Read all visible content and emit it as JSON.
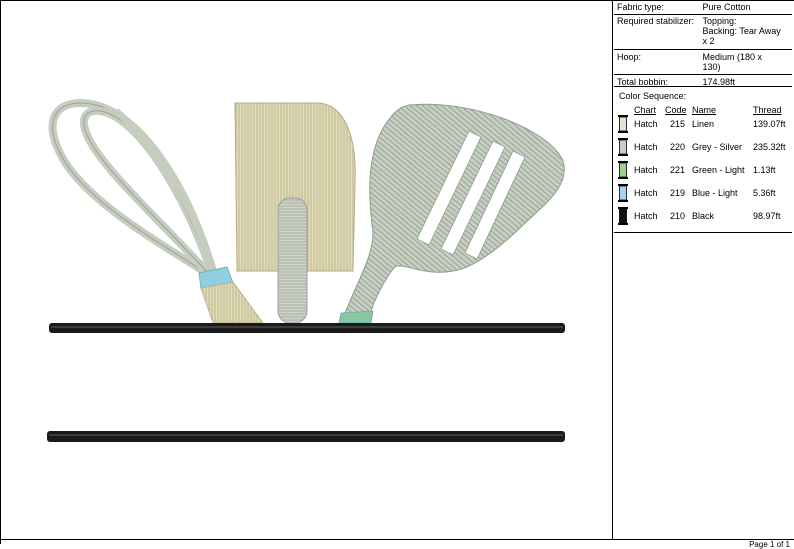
{
  "info": {
    "fabric_label": "Fabric type:",
    "fabric_value": "Pure Cotton",
    "stabilizer_label": "Required stabilizer:",
    "stabilizer_value_1": "Topping:",
    "stabilizer_value_2": "Backing: Tear Away",
    "stabilizer_value_3": "x 2",
    "hoop_label": "Hoop:",
    "hoop_value_1": "Medium (180 x",
    "hoop_value_2": "130)",
    "bobbin_label": "Total bobbin:",
    "bobbin_value": "174.98ft"
  },
  "color_sequence": {
    "title": "Color Sequence:",
    "headers": {
      "chart": "Chart",
      "code": "Code",
      "name": "Name",
      "thread": "Thread"
    },
    "rows": [
      {
        "chart": "Hatch",
        "code": "215",
        "name": "Linen",
        "thread": "139.07ft",
        "color": "#e8e1cf"
      },
      {
        "chart": "Hatch",
        "code": "220",
        "name": "Grey - Silver",
        "thread": "235.32ft",
        "color": "#c9cdc4"
      },
      {
        "chart": "Hatch",
        "code": "221",
        "name": "Green - Light",
        "thread": "1.13ft",
        "color": "#9fd08a"
      },
      {
        "chart": "Hatch",
        "code": "219",
        "name": "Blue - Light",
        "thread": "5.36ft",
        "color": "#a8d3ee"
      },
      {
        "chart": "Hatch",
        "code": "210",
        "name": "Black",
        "thread": "98.97ft",
        "color": "#111111"
      }
    ]
  },
  "footer": {
    "page": "Page 1 of 1"
  },
  "colors": {
    "linen": "#dcd6b0",
    "silver": "#c3c8bb",
    "sage": "#a6b4a2",
    "blue_band": "#8fd0e0",
    "green_band": "#86c8a0",
    "black": "#1a1a1a"
  }
}
